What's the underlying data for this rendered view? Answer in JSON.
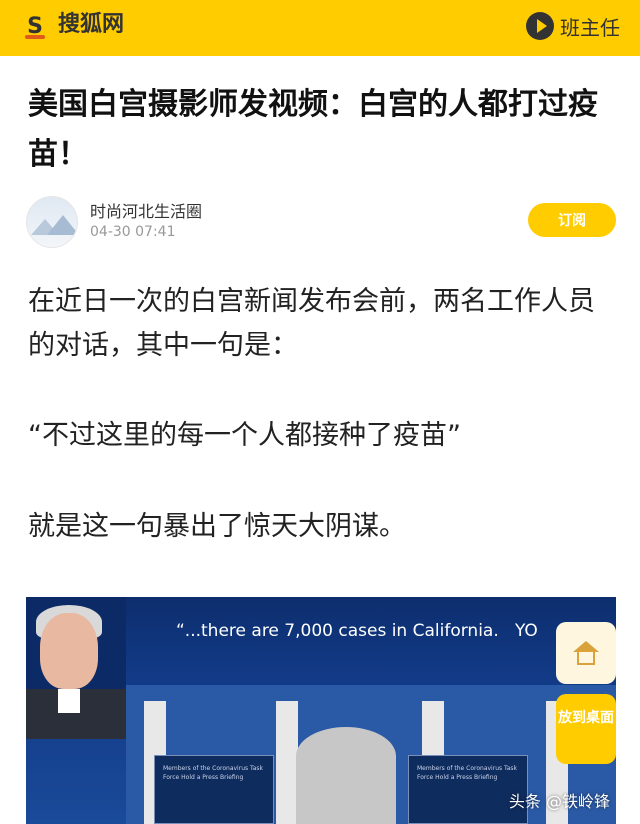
{
  "header": {
    "site_name": "搜狐网",
    "logo_letter": "S",
    "class_button": "班主任",
    "brand_color": "#ffcc00"
  },
  "article": {
    "title": "美国白宫摄影师发视频：白宫的人都打过疫苗！",
    "author": "时尚河北生活圈",
    "publish_time": "04-30 07:41",
    "subscribe_label": "订阅",
    "paragraphs": [
      "在近日一次的白宫新闻发布会前，两名工作人员的对话，其中一句是：",
      "“不过这里的每一个人都接种了疫苗”",
      "就是这一句暴出了惊天大阴谋。"
    ]
  },
  "video": {
    "caption": "“...there are 7,000 cases in California.",
    "caption_tail": "YO",
    "sign_text": "Members of the Coronavirus Task Force Hold a Press Briefing"
  },
  "floating": {
    "home_icon": "home-icon",
    "desktop_label": "放到桌面"
  },
  "watermark": "头条 @铁岭锋"
}
